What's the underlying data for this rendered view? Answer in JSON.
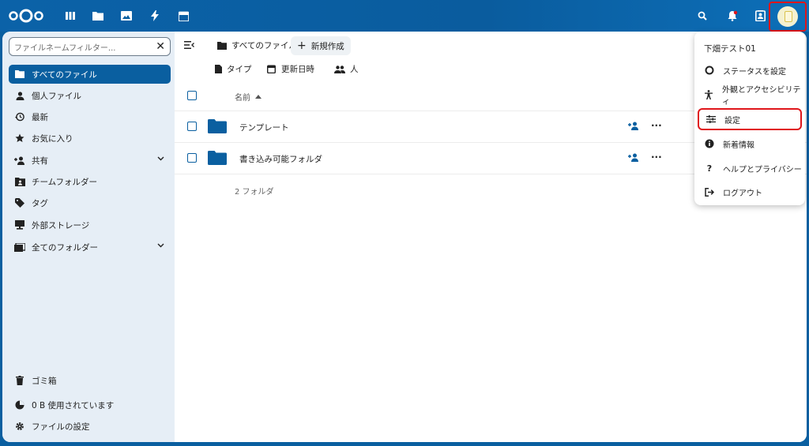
{
  "filter": {
    "placeholder": "ファイルネームフィルター..."
  },
  "sidebar": {
    "items": [
      {
        "label": "すべてのファイル",
        "icon": "folder-icon"
      },
      {
        "label": "個人ファイル",
        "icon": "user-icon"
      },
      {
        "label": "最新",
        "icon": "history-icon"
      },
      {
        "label": "お気に入り",
        "icon": "star-icon"
      },
      {
        "label": "共有",
        "icon": "share-icon"
      },
      {
        "label": "チームフォルダー",
        "icon": "team-folder-icon"
      },
      {
        "label": "タグ",
        "icon": "tag-icon"
      },
      {
        "label": "外部ストレージ",
        "icon": "external-storage-icon"
      },
      {
        "label": "全てのフォルダー",
        "icon": "all-folders-icon"
      }
    ],
    "trash": "ゴミ箱",
    "quota": "0 B 使用されています",
    "settings": "ファイルの設定"
  },
  "toolbar": {
    "breadcrumb": "すべてのファイル",
    "new_label": "新規作成"
  },
  "filters": {
    "type": "タイプ",
    "modified": "更新日時",
    "people": "人"
  },
  "table": {
    "header_name": "名前",
    "rows": [
      {
        "name": "テンプレート"
      },
      {
        "name": "書き込み可能フォルダ"
      }
    ],
    "summary": "2 フォルダ"
  },
  "user_menu": {
    "display_name": "下畑テスト01",
    "items": [
      {
        "label": "ステータスを設定",
        "icon": "status-circle-icon"
      },
      {
        "label": "外観とアクセシビリティ",
        "icon": "accessibility-icon"
      },
      {
        "label": "設定",
        "icon": "settings-sliders-icon"
      },
      {
        "label": "新着情報",
        "icon": "info-icon"
      },
      {
        "label": "ヘルプとプライバシー",
        "icon": "help-icon"
      },
      {
        "label": "ログアウト",
        "icon": "logout-icon"
      }
    ]
  },
  "colors": {
    "primary": "#0a5fa0",
    "highlight": "#e0161b",
    "sidebar_bg": "#e6eef6"
  }
}
